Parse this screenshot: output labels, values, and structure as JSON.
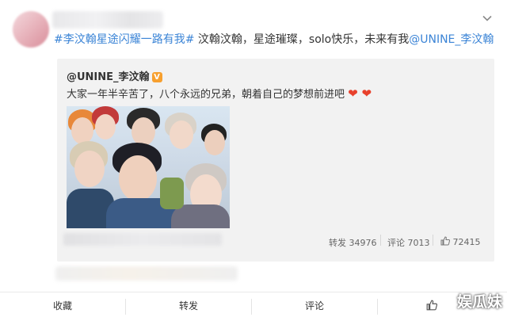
{
  "post": {
    "hashtag": "#李汶翰星途闪耀一路有我#",
    "text": " 汶翰汶翰，星途璀璨，solo快乐，未来有我",
    "mention": "@UNINE_李汶翰"
  },
  "quoted": {
    "author": "@UNINE_李汶翰",
    "verified_badge": "V",
    "text": "大家一年半辛苦了，八个永远的兄弟，朝着自己的梦想前进吧",
    "emoji": "❤ ❤",
    "stats": {
      "repost_label": "转发",
      "repost_count": "34976",
      "comment_label": "评论",
      "comment_count": "7013",
      "like_count": "72415"
    }
  },
  "toolbar": {
    "collect": "收藏",
    "repost": "转发",
    "comment": "评论"
  },
  "watermark": "娱瓜妹",
  "colors": {
    "link": "#3b84d6",
    "heart": "#e8412c",
    "badge": "#f7a02f"
  }
}
